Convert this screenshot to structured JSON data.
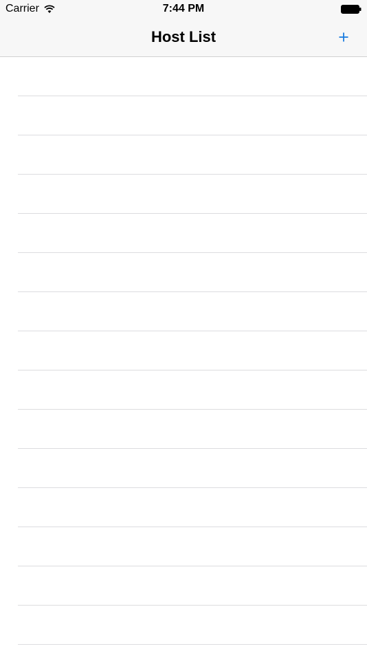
{
  "status_bar": {
    "carrier": "Carrier",
    "time": "7:44 PM"
  },
  "nav_bar": {
    "title": "Host List",
    "add_icon": "plus-icon",
    "accent_color": "#1a7be0"
  },
  "host_list": {
    "rows": [
      {
        "label": ""
      },
      {
        "label": ""
      },
      {
        "label": ""
      },
      {
        "label": ""
      },
      {
        "label": ""
      },
      {
        "label": ""
      },
      {
        "label": ""
      },
      {
        "label": ""
      },
      {
        "label": ""
      },
      {
        "label": ""
      },
      {
        "label": ""
      },
      {
        "label": ""
      },
      {
        "label": ""
      },
      {
        "label": ""
      },
      {
        "label": ""
      }
    ]
  }
}
